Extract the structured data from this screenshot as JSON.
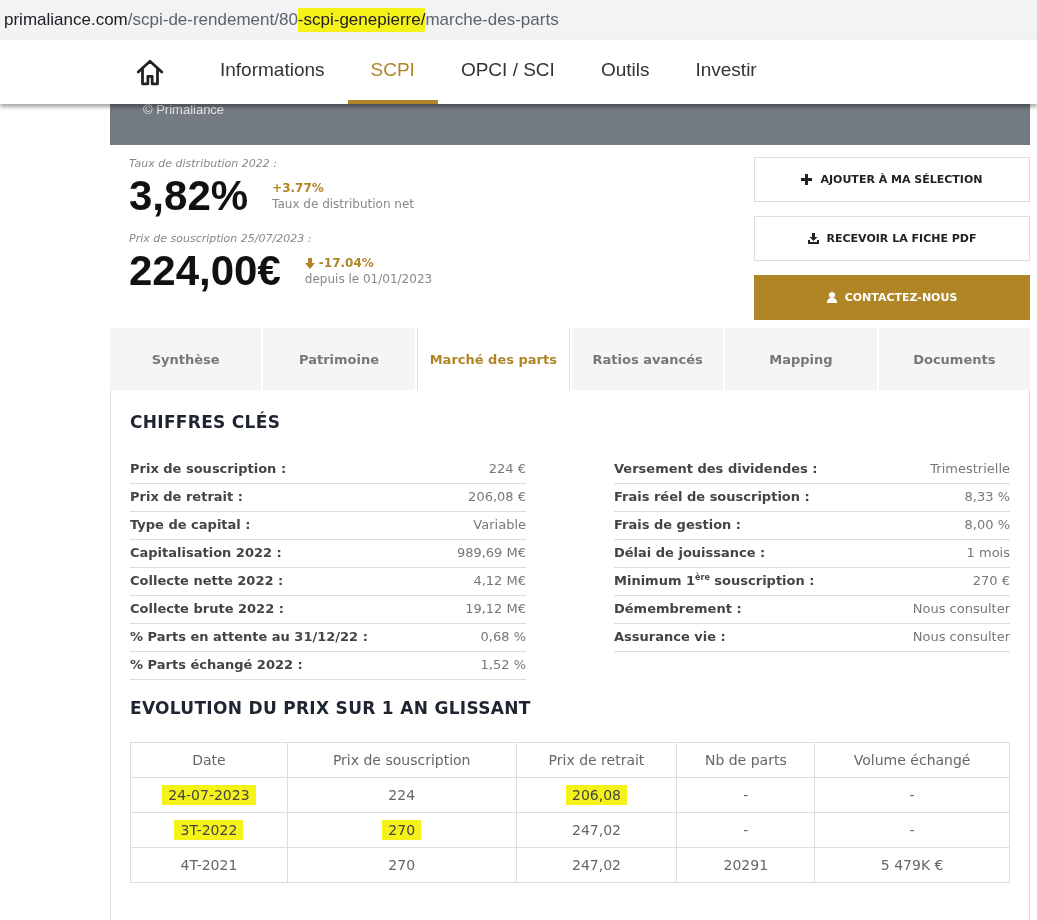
{
  "address_bar": {
    "segments": [
      {
        "text": "primaliance.com",
        "highlighted": false,
        "kind": "host"
      },
      {
        "text": "/scpi-de-rendement/80",
        "highlighted": false,
        "kind": "path"
      },
      {
        "text": "-scpi-genepierre/",
        "highlighted": true,
        "kind": "path"
      },
      {
        "text": "marche-des-parts",
        "highlighted": false,
        "kind": "path"
      }
    ]
  },
  "nav": {
    "items": [
      {
        "label": "Informations",
        "selected": false
      },
      {
        "label": "SCPI",
        "selected": true
      },
      {
        "label": "OPCI / SCI",
        "selected": false
      },
      {
        "label": "Outils",
        "selected": false
      },
      {
        "label": "Investir",
        "selected": false
      }
    ]
  },
  "banner": {
    "credit": "© Primaliance"
  },
  "summary": {
    "rate_label": "Taux de distribution 2022 :",
    "rate": "3,82%",
    "rate_change": "+3.77%",
    "rate_note": "Taux de distribution net",
    "price_label": "Prix de souscription 25/07/2023 :",
    "price": "224,00€",
    "price_change": "-17.04%",
    "price_falling": true,
    "price_note": "depuis le 01/01/2023"
  },
  "actions": [
    {
      "label": "AJOUTER À MA SÉLECTION",
      "kind": "plus",
      "primary": false
    },
    {
      "label": "RECEVOIR LA FICHE PDF",
      "kind": "download",
      "primary": false
    },
    {
      "label": "CONTACTEZ-NOUS",
      "kind": "user",
      "primary": true
    }
  ],
  "tabs": [
    {
      "label": "Synthèse",
      "selected": false
    },
    {
      "label": "Patrimoine",
      "selected": false
    },
    {
      "label": "Marché des parts",
      "selected": true
    },
    {
      "label": "Ratios avancés",
      "selected": false
    },
    {
      "label": "Mapping",
      "selected": false
    },
    {
      "label": "Documents",
      "selected": false
    }
  ],
  "key_figures": {
    "title": "CHIFFRES CLÉS",
    "left": [
      {
        "label": "Prix de souscription :",
        "value": "224 €"
      },
      {
        "label": "Prix de retrait :",
        "value": "206,08 €"
      },
      {
        "label": "Type de capital :",
        "value": "Variable"
      },
      {
        "label": "Capitalisation 2022 :",
        "value": "989,69 M€"
      },
      {
        "label": "Collecte nette 2022 :",
        "value": "4,12 M€"
      },
      {
        "label": "Collecte brute 2022 :",
        "value": "19,12 M€"
      },
      {
        "label": "% Parts en attente au 31/12/22 :",
        "value": "0,68 %"
      },
      {
        "label": "% Parts échangé 2022 :",
        "value": "1,52 %"
      }
    ],
    "right": [
      {
        "label": "Versement des dividendes :",
        "value": "Trimestrielle"
      },
      {
        "label": "Frais réel de souscription :",
        "value": "8,33 %"
      },
      {
        "label": "Frais de gestion :",
        "value": "8,00 %"
      },
      {
        "label": "Délai de jouissance :",
        "value": "1 mois"
      },
      {
        "label": "Minimum 1$^{ère}$ souscription :",
        "value": "270 €"
      },
      {
        "label": "Démembrement :",
        "value": "Nous consulter"
      },
      {
        "label": "Assurance vie :",
        "value": "Nous consulter"
      }
    ]
  },
  "price_history": {
    "title": "EVOLUTION DU PRIX SUR 1 AN GLISSANT",
    "columns": [
      "Date",
      "Prix de souscription",
      "Prix de retrait",
      "Nb de parts",
      "Volume échangé"
    ],
    "rows": [
      [
        {
          "text": "24-07-2023",
          "highlighted": true
        },
        {
          "text": "224",
          "highlighted": false
        },
        {
          "text": "206,08",
          "highlighted": true
        },
        {
          "text": "-",
          "highlighted": false
        },
        {
          "text": "-",
          "highlighted": false
        }
      ],
      [
        {
          "text": "3T-2022",
          "highlighted": true
        },
        {
          "text": "270",
          "highlighted": true
        },
        {
          "text": "247,02",
          "highlighted": false
        },
        {
          "text": "-",
          "highlighted": false
        },
        {
          "text": "-",
          "highlighted": false
        }
      ],
      [
        {
          "text": "4T-2021",
          "highlighted": false
        },
        {
          "text": "270",
          "highlighted": false
        },
        {
          "text": "247,02",
          "highlighted": false
        },
        {
          "text": "20291",
          "highlighted": false
        },
        {
          "text": "5 479K €",
          "highlighted": false
        }
      ]
    ]
  }
}
